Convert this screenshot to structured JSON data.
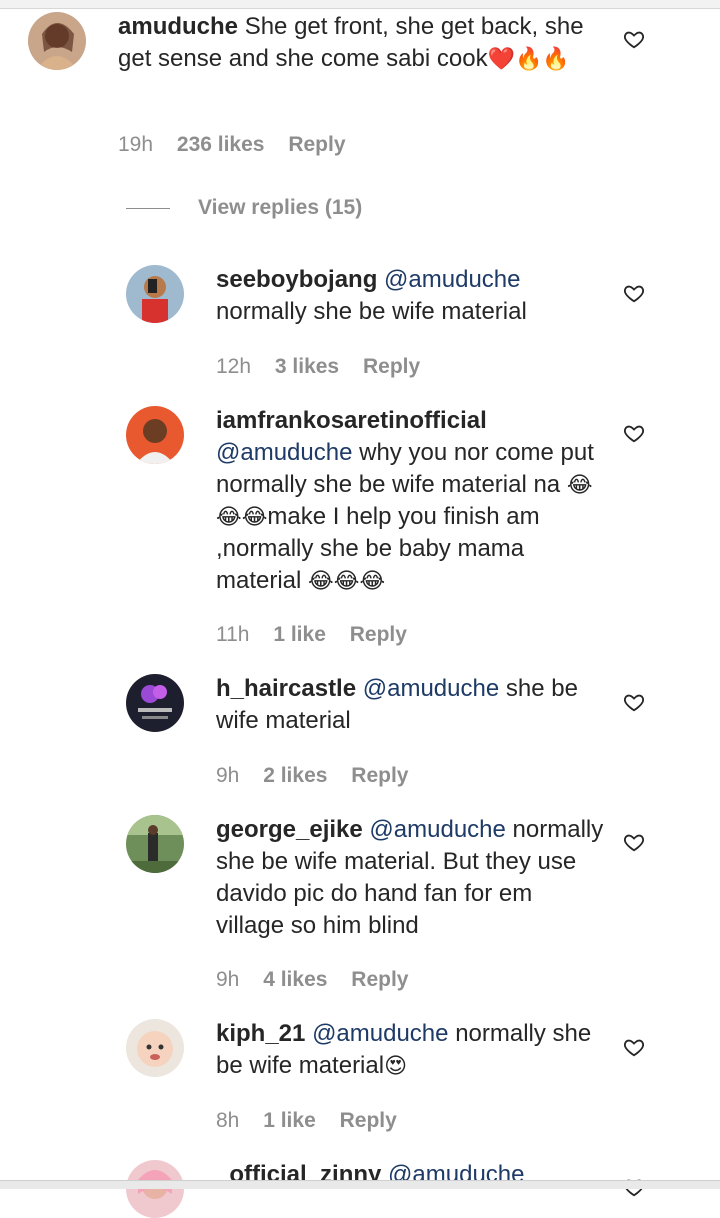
{
  "comments": [
    {
      "username": "amuduche",
      "mention": "",
      "text": "She get front, she get back, she get sense and she come sabi cook",
      "emojis": "❤️🔥🔥",
      "time": "19h",
      "likes": "236 likes",
      "reply": "Reply"
    },
    {
      "username": "seeboybojang",
      "mention": "@amuduche",
      "text": "normally she be wife material",
      "emojis": "",
      "time": "12h",
      "likes": "3 likes",
      "reply": "Reply"
    },
    {
      "username": "iamfrankosaretinofficial",
      "mention": "@amuduche",
      "text": "why you nor come put normally she be wife material na",
      "emojis1": "😂😂😂",
      "text2": "make I help you finish am ,normally she be baby mama material",
      "emojis2": "😂😂😂",
      "time": "11h",
      "likes": "1 like",
      "reply": "Reply"
    },
    {
      "username": "h_haircastle",
      "mention": "@amuduche",
      "text": "she be wife material",
      "emojis": "",
      "time": "9h",
      "likes": "2 likes",
      "reply": "Reply"
    },
    {
      "username": "george_ejike",
      "mention": "@amuduche",
      "text": "normally she be wife material. But they use davido pic do hand fan for em village so him blind",
      "emojis": "",
      "time": "9h",
      "likes": "4 likes",
      "reply": "Reply"
    },
    {
      "username": "kiph_21",
      "mention": "@amuduche",
      "text": "normally she be wife material",
      "emojis": "😍",
      "time": "8h",
      "likes": "1 like",
      "reply": "Reply"
    },
    {
      "username": "_official_zinny",
      "mention": "@amuduche",
      "text": "",
      "emojis": "",
      "time": "",
      "likes": "",
      "reply": ""
    }
  ],
  "view_replies": "View replies (15)",
  "icons": {
    "like": "heart-outline-icon"
  },
  "colors": {
    "mention": "#1e3a66",
    "meta": "#8e8e8e",
    "text": "#262626"
  }
}
